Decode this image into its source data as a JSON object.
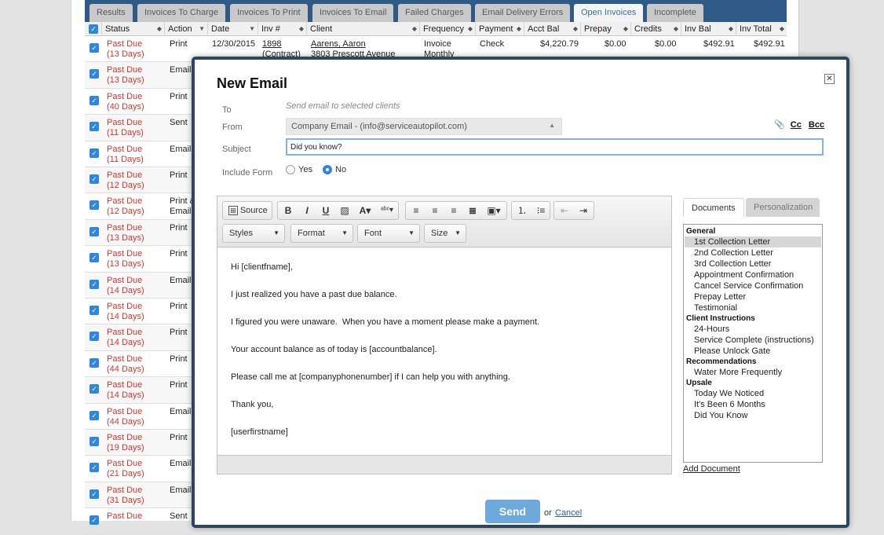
{
  "tabs": [
    {
      "label": "Results"
    },
    {
      "label": "Invoices To Charge"
    },
    {
      "label": "Invoices To Print"
    },
    {
      "label": "Invoices To Email"
    },
    {
      "label": "Failed Charges"
    },
    {
      "label": "Email Delivery Errors"
    },
    {
      "label": "Open Invoices"
    },
    {
      "label": "Incomplete"
    }
  ],
  "active_tab": "Open Invoices",
  "columns": [
    {
      "label": "Status"
    },
    {
      "label": "Action"
    },
    {
      "label": "Date"
    },
    {
      "label": "Inv #"
    },
    {
      "label": "Client"
    },
    {
      "label": "Frequency"
    },
    {
      "label": "Payment"
    },
    {
      "label": "Acct Bal"
    },
    {
      "label": "Prepay"
    },
    {
      "label": "Credits"
    },
    {
      "label": "Inv Bal"
    },
    {
      "label": "Inv Total"
    }
  ],
  "checkmark": "✓",
  "first_row": {
    "date": "12/30/2015",
    "inv_num": "1898",
    "inv_type": "(Contract)",
    "client_name": "Aarens, Aaron",
    "client_address": "3803 Prescott Avenue",
    "frequency_1": "Invoice",
    "frequency_2": "Monthly",
    "payment": "Check",
    "acct_bal": "$4,220.79",
    "prepay": "$0.00",
    "credits": "$0.00",
    "inv_bal": "$492.91",
    "inv_total": "$492.91"
  },
  "rows": [
    {
      "status": "Past Due",
      "days": "(13 Days)",
      "action": "Print"
    },
    {
      "status": "Past Due",
      "days": "(13 Days)",
      "action": "Email"
    },
    {
      "status": "Past Due",
      "days": "(40 Days)",
      "action": "Print"
    },
    {
      "status": "Past Due",
      "days": "(11 Days)",
      "action": "Sent"
    },
    {
      "status": "Past Due",
      "days": "(11 Days)",
      "action": "Email"
    },
    {
      "status": "Past Due",
      "days": "(12 Days)",
      "action": "Print"
    },
    {
      "status": "Past Due",
      "days": "(12 Days)",
      "action": "Print & Email"
    },
    {
      "status": "Past Due",
      "days": "(13 Days)",
      "action": "Print"
    },
    {
      "status": "Past Due",
      "days": "(13 Days)",
      "action": "Print"
    },
    {
      "status": "Past Due",
      "days": "(14 Days)",
      "action": "Email"
    },
    {
      "status": "Past Due",
      "days": "(14 Days)",
      "action": "Print"
    },
    {
      "status": "Past Due",
      "days": "(14 Days)",
      "action": "Print"
    },
    {
      "status": "Past Due",
      "days": "(44 Days)",
      "action": "Print"
    },
    {
      "status": "Past Due",
      "days": "(14 Days)",
      "action": "Print"
    },
    {
      "status": "Past Due",
      "days": "(44 Days)",
      "action": "Email"
    },
    {
      "status": "Past Due",
      "days": "(19 Days)",
      "action": "Print"
    },
    {
      "status": "Past Due",
      "days": "(21 Days)",
      "action": "Email"
    },
    {
      "status": "Past Due",
      "days": "(31 Days)",
      "action": "Email"
    },
    {
      "status": "Past Due",
      "days": "",
      "action": "Sent"
    }
  ],
  "modal": {
    "title": "New Email",
    "close_symbol": "✕",
    "to_label": "To",
    "to_value": "Send email to selected clients",
    "from_label": "From",
    "from_value": "Company Email - (info@serviceautopilot.com)",
    "cc_label": "Cc",
    "bcc_label": "Bcc",
    "subject_label": "Subject",
    "subject_value": "Did you know?",
    "include_form_label": "Include Form",
    "yes_label": "Yes",
    "no_label": "No",
    "include_form_value": "No",
    "send_label": "Send",
    "or_text": "or",
    "cancel_label": "Cancel"
  },
  "toolbar": {
    "source_label": "Source",
    "bold_label": "B",
    "italic_label": "I",
    "underline_label": "U",
    "styles_label": "Styles",
    "format_label": "Format",
    "font_label": "Font",
    "size_label": "Size"
  },
  "body_lines": [
    "Hi [clientfname],",
    "I just realized you have a past due balance.",
    "I figured you were unaware.  When you have a moment please make a payment.",
    "Your account balance as of today is [accountbalance].",
    "Please call me at [companyphonenumber] if I can help you with anything.",
    "Thank you,",
    "[userfirstname]"
  ],
  "documents": {
    "tab_documents": "Documents",
    "tab_personalization": "Personalization",
    "add_document": "Add Document",
    "selected_item": "1st Collection Letter",
    "groups": [
      {
        "name": "General",
        "items": [
          "1st Collection Letter",
          "2nd Collection Letter",
          "3rd Collection Letter",
          "Appointment Confirmation",
          "Cancel Service Confirmation",
          "Prepay Letter",
          "Testimonial"
        ]
      },
      {
        "name": "Client Instructions",
        "items": [
          "24-Hours",
          "Service Complete (instructions)",
          "Please Unlock Gate"
        ]
      },
      {
        "name": "Recommendations",
        "items": [
          "Water More Frequently"
        ]
      },
      {
        "name": "Upsale",
        "items": [
          "Today We Noticed",
          "It's Been 6 Months",
          "Did You Know"
        ]
      }
    ]
  },
  "colors": {
    "tab_bar": "#2f5a86",
    "past_due": "#d8342c",
    "checkbox": "#2f86dd",
    "modal_border": "#2c4660",
    "send_button": "#6ea9dd"
  }
}
